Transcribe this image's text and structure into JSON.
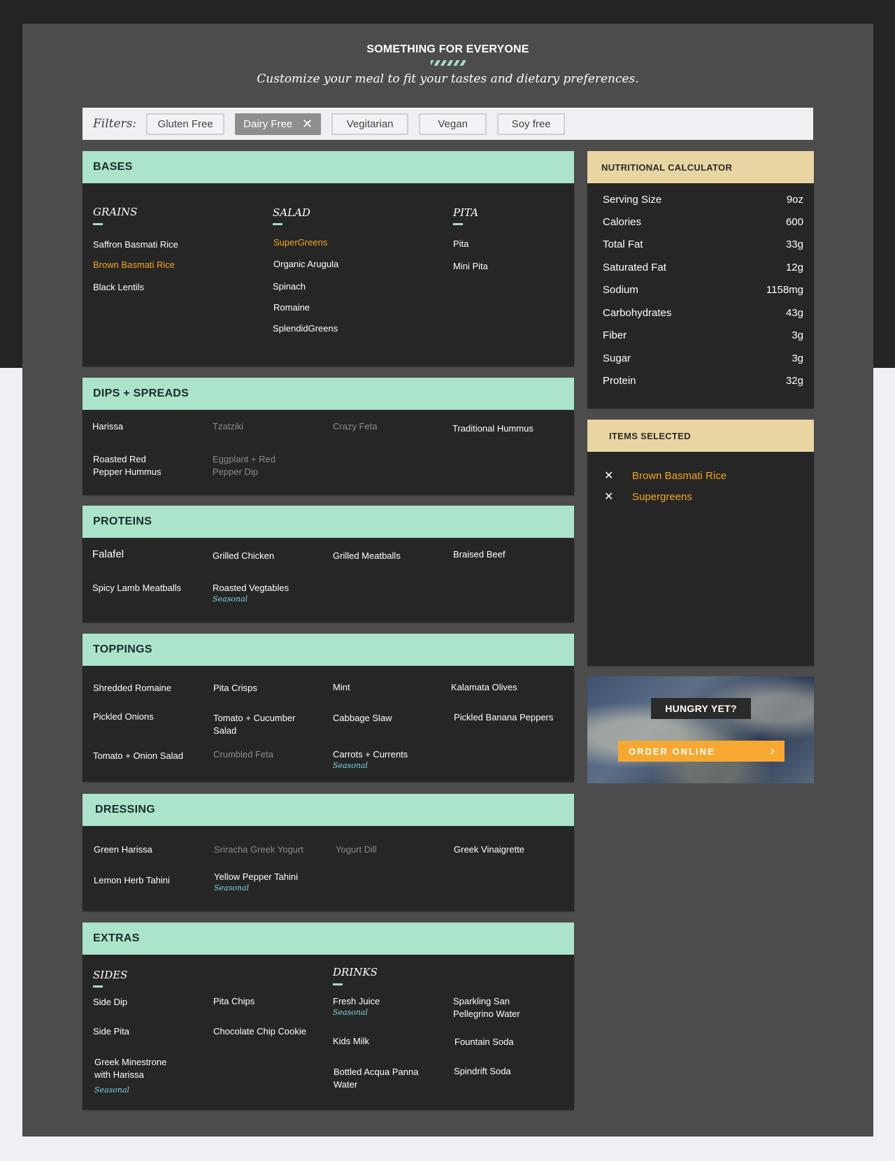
{
  "hero": {
    "title": "SOMETHING FOR EVERYONE",
    "subtitle": "Customize your meal to fit your tastes and dietary preferences."
  },
  "filters": {
    "label": "Filters:",
    "chips": [
      "Gluten Free",
      "Dairy Free",
      "Vegitarian",
      "Vegan",
      "Soy free"
    ],
    "active": "Dairy Free",
    "remove_glyph": "✕"
  },
  "bases": {
    "title": "BASES",
    "columns": [
      {
        "title": "GRAINS",
        "items": [
          "Saffron Basmati Rice",
          "Brown Basmati Rice",
          "Black Lentils"
        ]
      },
      {
        "title": "SALAD",
        "items": [
          "SuperGreens",
          "Organic Arugula",
          "Spinach",
          "Romaine",
          "SplendidGreens"
        ]
      },
      {
        "title": "PITA",
        "items": [
          "Pita",
          "Mini Pita"
        ]
      }
    ]
  },
  "dips": {
    "title": "DIPS + SPREADS",
    "items": [
      "Harissa",
      "Tzatziki",
      "Crazy Feta",
      "Traditional Hummus",
      "Roasted Red Pepper Hummus",
      "Eggplant + Red Pepper Dip"
    ]
  },
  "proteins": {
    "title": "PROTEINS",
    "items": [
      "Falafel",
      "Grilled Chicken",
      "Grilled Meatballs",
      "Braised Beef",
      "Spicy Lamb Meatballs",
      "Roasted Vegtables"
    ]
  },
  "toppings": {
    "title": "TOPPINGS",
    "items": [
      "Shredded Romaine",
      "Pita Crisps",
      "Mint",
      "Kalamata Olives",
      "Pickled Onions",
      "Tomato + Cucumber Salad",
      "Cabbage Slaw",
      "Pickled Banana Peppers",
      "Tomato + Onion Salad",
      "Crumbled Feta",
      "Carrots + Currents"
    ]
  },
  "dressing": {
    "title": "DRESSING",
    "items": [
      "Green Harissa",
      "Sriracha Greek Yogurt",
      "Yogurt Dill",
      "Greek Vinaigrette",
      "Lemon Herb Tahini",
      "Yellow Pepper Tahini"
    ]
  },
  "extras": {
    "title": "EXTRAS",
    "sides_title": "SIDES",
    "drinks_title": "DRINKS",
    "sides": [
      "Side Dip",
      "Pita Chips",
      "Side Pita",
      "Chocolate Chip Cookie",
      "Greek Minestrone with Harissa"
    ],
    "drinks": [
      "Fresh Juice",
      "Sparkling San Pellegrino Water",
      "Kids Milk",
      "Fountain Soda",
      "Bottled Acqua Panna Water",
      "Spindrift Soda"
    ]
  },
  "seasonal_label": "Seasonal",
  "nutrition": {
    "title": "NUTRITIONAL CALCULATOR",
    "rows": [
      {
        "label": "Serving Size",
        "value": "9oz"
      },
      {
        "label": "Calories",
        "value": "600"
      },
      {
        "label": "Total Fat",
        "value": "33g"
      },
      {
        "label": "Saturated Fat",
        "value": "12g"
      },
      {
        "label": "Sodium",
        "value": "1158mg"
      },
      {
        "label": "Carbohydrates",
        "value": "43g"
      },
      {
        "label": "Fiber",
        "value": "3g"
      },
      {
        "label": "Sugar",
        "value": "3g"
      },
      {
        "label": "Protein",
        "value": "32g"
      }
    ]
  },
  "items_selected": {
    "title": "ITEMS SELECTED",
    "remove_glyph": "✕",
    "items": [
      "Brown Basmati Rice",
      "Supergreens"
    ]
  },
  "promo": {
    "hungry": "HUNGRY YET?",
    "order": "ORDER ONLINE",
    "chevron": "›"
  },
  "colors": {
    "mint": "#ace4cb",
    "tan": "#e8d5a2",
    "orange": "#f5a623",
    "seasonal": "#7fd7e0",
    "panel": "#262626"
  }
}
